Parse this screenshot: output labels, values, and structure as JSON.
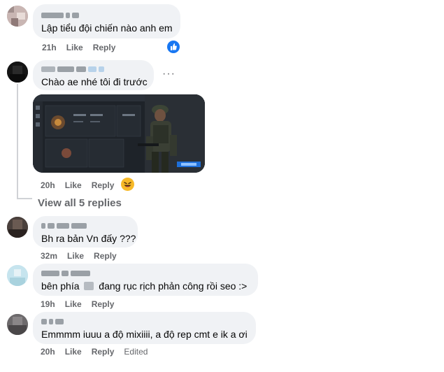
{
  "comments": [
    {
      "text": "Lập tiểu đội chiến nào anh em",
      "time": "21h",
      "like": "Like",
      "reply": "Reply",
      "reaction": "like-reaction-icon"
    },
    {
      "text": "Chào ae nhé tôi đi trước",
      "time": "20h",
      "like": "Like",
      "reply": "Reply",
      "more": "···",
      "reaction": "haha-reaction-icon"
    },
    {
      "text": "Bh ra bản Vn đấy ???",
      "time": "32m",
      "like": "Like",
      "reply": "Reply"
    },
    {
      "text_before": "bên phía",
      "text_after": "đang rục rịch phản công rồi seo :>",
      "time": "19h",
      "like": "Like",
      "reply": "Reply"
    },
    {
      "text": "Emmmm iuuu a độ mixiiii, a độ rep cmt e ik a ơi",
      "time": "20h",
      "like": "Like",
      "reply": "Reply",
      "edited": "Edited"
    }
  ],
  "view_replies": "View all 5 replies",
  "colors": {
    "bubble": "#f0f2f5",
    "meta": "#65676b",
    "like_blue": "#1877f2",
    "haha_yellow": "#f7b928"
  }
}
